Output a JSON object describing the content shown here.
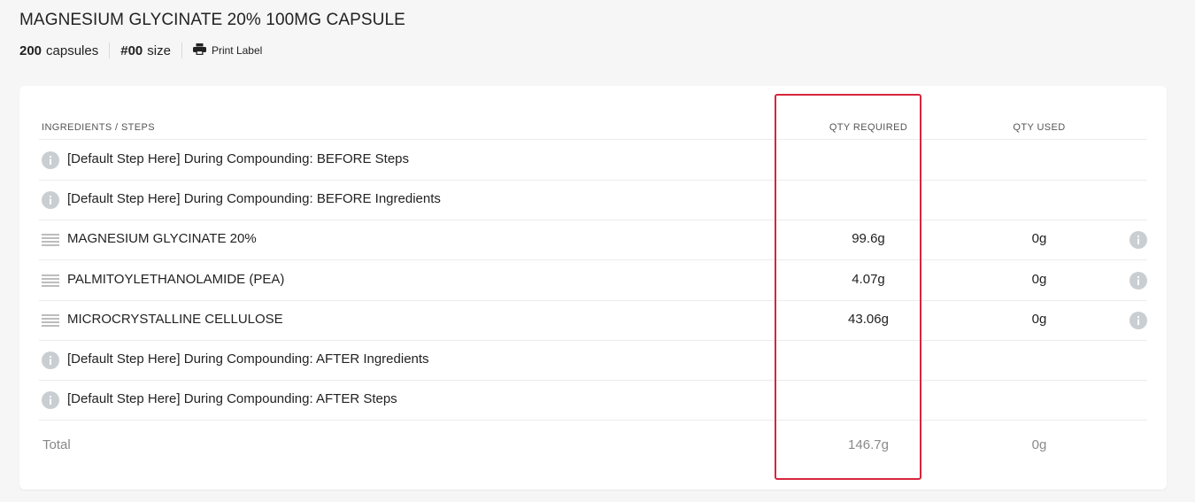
{
  "header": {
    "title": "MAGNESIUM GLYCINATE 20% 100MG CAPSULE",
    "count_value": "200",
    "count_unit": "capsules",
    "size_value": "#00",
    "size_unit": "size",
    "print_label": "Print Label",
    "print_icon": "printer-icon"
  },
  "table": {
    "columns": {
      "ingredients": "INGREDIENTS / STEPS",
      "qty_required": "QTY REQUIRED",
      "qty_used": "QTY USED"
    },
    "rows": [
      {
        "type": "step",
        "icon": "info-icon",
        "label": "[Default Step Here] During Compounding: BEFORE Steps",
        "qty_required": "",
        "qty_used": ""
      },
      {
        "type": "step",
        "icon": "info-icon",
        "label": "[Default Step Here] During Compounding: BEFORE Ingredients",
        "qty_required": "",
        "qty_used": ""
      },
      {
        "type": "ingredient",
        "icon": "drag-handle-icon",
        "label": "MAGNESIUM GLYCINATE 20%",
        "qty_required": "99.6g",
        "qty_used": "0g"
      },
      {
        "type": "ingredient",
        "icon": "drag-handle-icon",
        "label": "PALMITOYLETHANOLAMIDE (PEA)",
        "qty_required": "4.07g",
        "qty_used": "0g"
      },
      {
        "type": "ingredient",
        "icon": "drag-handle-icon",
        "label": "MICROCRYSTALLINE CELLULOSE",
        "qty_required": "43.06g",
        "qty_used": "0g"
      },
      {
        "type": "step",
        "icon": "info-icon",
        "label": "[Default Step Here] During Compounding: AFTER Ingredients",
        "qty_required": "",
        "qty_used": ""
      },
      {
        "type": "step",
        "icon": "info-icon",
        "label": "[Default Step Here] During Compounding: AFTER Steps",
        "qty_required": "",
        "qty_used": ""
      }
    ],
    "total": {
      "label": "Total",
      "qty_required": "146.7g",
      "qty_used": "0g"
    }
  },
  "colors": {
    "highlight_border": "#d7263d",
    "info_icon": "#c9ced3",
    "background": "#f6f6f7"
  }
}
